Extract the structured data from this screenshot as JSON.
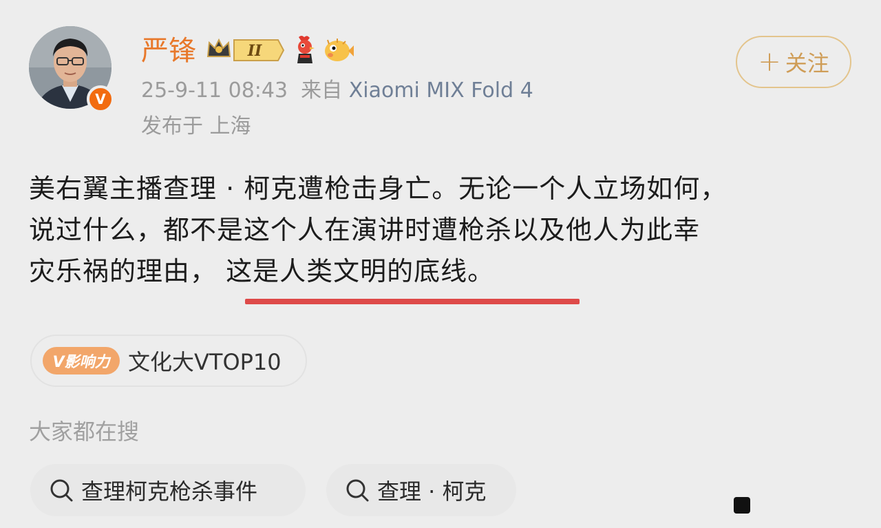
{
  "post": {
    "author_name": "严锋",
    "vip_level": "II",
    "timestamp": "25-9-11 08:43",
    "source_prefix": "来自",
    "device": "Xiaomi MIX Fold 4",
    "location": "发布于 上海",
    "follow_label": "关注",
    "content_lines": [
      "美右翼主播查理 · 柯克遭枪击身亡。无论一个人立场如何，",
      "说过什么，都不是这个人在演讲时遭枪杀以及他人为此幸",
      "灾乐祸的理由，"
    ],
    "content_highlight": "这是人类文明的底线。"
  },
  "tag": {
    "badge_label": "V影响力",
    "text": "文化大VTOP10"
  },
  "searches": {
    "label": "大家都在搜",
    "items": [
      {
        "text": "查理柯克枪杀事件"
      },
      {
        "text": "查理 · 柯克"
      }
    ]
  },
  "colors": {
    "name": "#e8782a",
    "follow_border": "#e3c48c",
    "underline": "#de4a49",
    "device_text": "#6f7f96"
  }
}
